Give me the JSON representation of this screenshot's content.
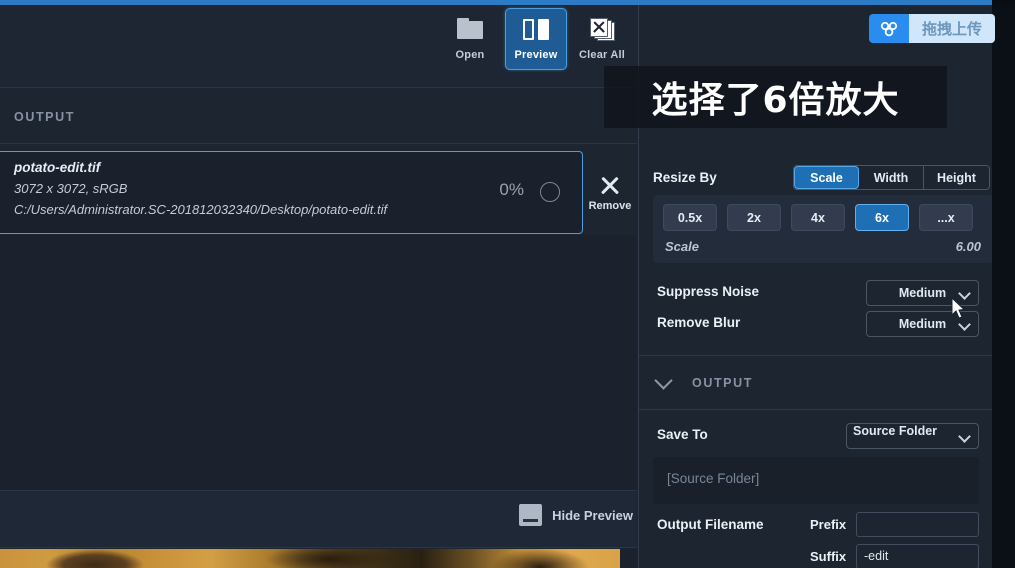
{
  "badge": {
    "icon": "baidu-cloud-icon",
    "label": "拖拽上传"
  },
  "caption": {
    "text": "选择了6倍放大"
  },
  "toolbar": {
    "buttons": [
      {
        "label": "Open",
        "icon": "folder-icon",
        "active": false
      },
      {
        "label": "Preview",
        "icon": "split-view-icon",
        "active": true
      },
      {
        "label": "Clear All",
        "icon": "clear-all-icon",
        "active": false
      }
    ]
  },
  "left_panel": {
    "section_header": "OUTPUT",
    "file": {
      "name": "potato-edit.tif",
      "dimensions": "3072 x 3072, sRGB",
      "path": "C:/Users/Administrator.SC-201812032340/Desktop/potato-edit.tif",
      "progress": "0%"
    },
    "remove_label": "Remove",
    "hide_preview_label": "Hide Preview"
  },
  "right_panel": {
    "resize_by": {
      "label": "Resize By",
      "options": [
        "Scale",
        "Width",
        "Height"
      ],
      "selected": "Scale"
    },
    "scale": {
      "presets": [
        "0.5x",
        "2x",
        "4x",
        "6x",
        "...x"
      ],
      "selected": "6x",
      "value_label": "Scale",
      "value": "6.00"
    },
    "suppress_noise": {
      "label": "Suppress Noise",
      "value": "Medium"
    },
    "remove_blur": {
      "label": "Remove Blur",
      "value": "Medium"
    },
    "output_section": {
      "header": "OUTPUT",
      "save_to_label": "Save To",
      "save_to_value": "Source Folder",
      "path_placeholder": "[Source Folder]",
      "output_filename_label": "Output Filename",
      "prefix_label": "Prefix",
      "prefix_value": "",
      "suffix_label": "Suffix",
      "suffix_value": "-edit"
    }
  },
  "colors": {
    "accent_blue": "#2b7cc4",
    "selection_blue": "#1f6fb5",
    "panel_bg": "#1d2531",
    "badge_blue": "#2b8cf0"
  }
}
